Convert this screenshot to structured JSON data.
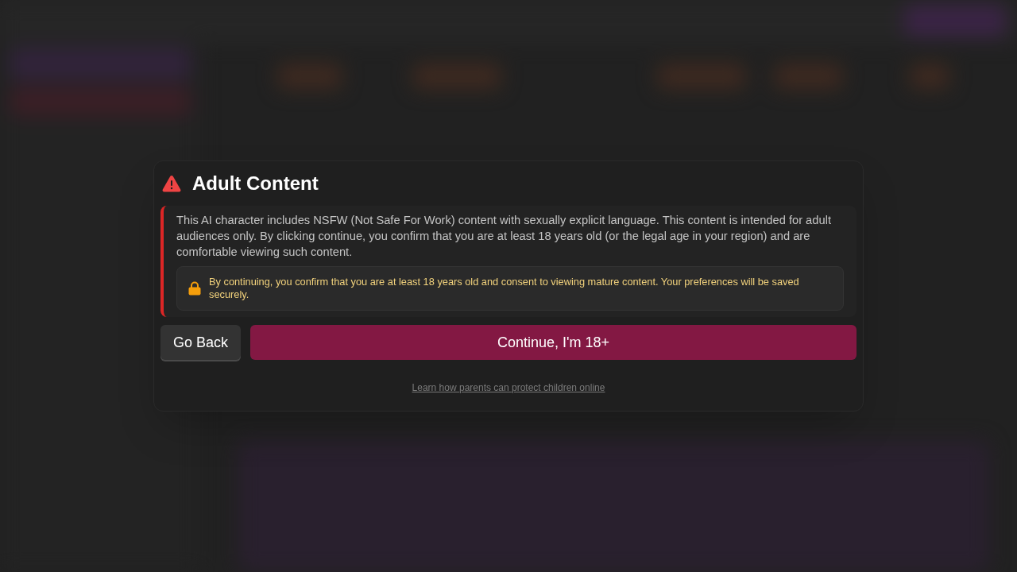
{
  "dialog": {
    "title": "Adult Content",
    "warning": {
      "message": "This AI character includes NSFW (Not Safe For Work) content with sexually explicit language. This content is intended for adult audiences only. By clicking continue, you confirm that you are at least 18 years old (or the legal age in your region) and are comfortable viewing such content.",
      "notice": "By continuing, you confirm that you are at least 18 years old and consent to viewing mature content. Your preferences will be saved securely."
    },
    "buttons": [
      {
        "label": "Go Back",
        "kind": "secondary"
      },
      {
        "label": "Continue, I'm 18+",
        "kind": "primary"
      }
    ],
    "link": "Learn how parents can protect children online"
  }
}
